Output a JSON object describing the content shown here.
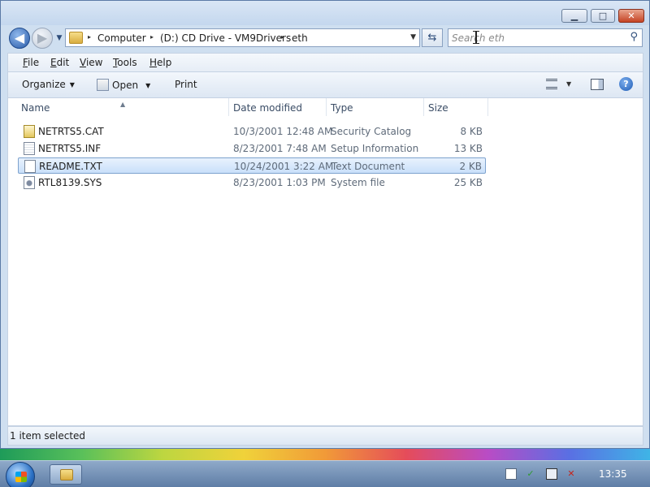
{
  "window": {
    "controls": {
      "minimize": "▁",
      "maximize": "□",
      "close": "✕"
    }
  },
  "nav": {
    "back_icon": "◀",
    "forward_icon": "▶",
    "recent_icon": "▼",
    "breadcrumb": [
      "Computer",
      "(D:) CD Drive - VM9Drivers",
      "eth"
    ],
    "breadcrumb_separator": "▸",
    "address_dropdown_icon": "▼",
    "refresh_icon": "⇆",
    "search": {
      "placeholder": "Search eth",
      "value": "",
      "icon": "⚲"
    }
  },
  "menu": {
    "items": [
      {
        "first": "F",
        "rest": "ile"
      },
      {
        "first": "E",
        "rest": "dit"
      },
      {
        "first": "V",
        "rest": "iew"
      },
      {
        "first": "T",
        "rest": "ools"
      },
      {
        "first": "H",
        "rest": "elp"
      }
    ]
  },
  "toolbar": {
    "organize": "Organize",
    "open": "Open",
    "print": "Print",
    "caret": "▼",
    "help_icon": "?"
  },
  "columns": {
    "name": "Name",
    "date": "Date modified",
    "type": "Type",
    "size": "Size",
    "sort_indicator": "▲"
  },
  "files": [
    {
      "name": "NETRTS5.CAT",
      "date": "10/3/2001 12:48 AM",
      "type": "Security Catalog",
      "size": "8 KB",
      "icon": "catalog-file-icon",
      "selected": false
    },
    {
      "name": "NETRTS5.INF",
      "date": "8/23/2001 7:48 AM",
      "type": "Setup Information",
      "size": "13 KB",
      "icon": "setup-info-file-icon",
      "selected": false
    },
    {
      "name": "README.TXT",
      "date": "10/24/2001 3:22 AM",
      "type": "Text Document",
      "size": "2 KB",
      "icon": "text-file-icon",
      "selected": true
    },
    {
      "name": "RTL8139.SYS",
      "date": "8/23/2001 1:03 PM",
      "type": "System file",
      "size": "25 KB",
      "icon": "system-file-icon",
      "selected": false
    }
  ],
  "status": {
    "text": "1 item selected"
  },
  "taskbar": {
    "clock": "13:35",
    "tray_icons": [
      "action-center-icon",
      "network-icon",
      "display-icon",
      "volume-muted-icon"
    ]
  },
  "colors": {
    "selection_fill": "#c9e0fa",
    "selection_border": "#7da2ce",
    "secondary_text": "#5f6b7a"
  }
}
